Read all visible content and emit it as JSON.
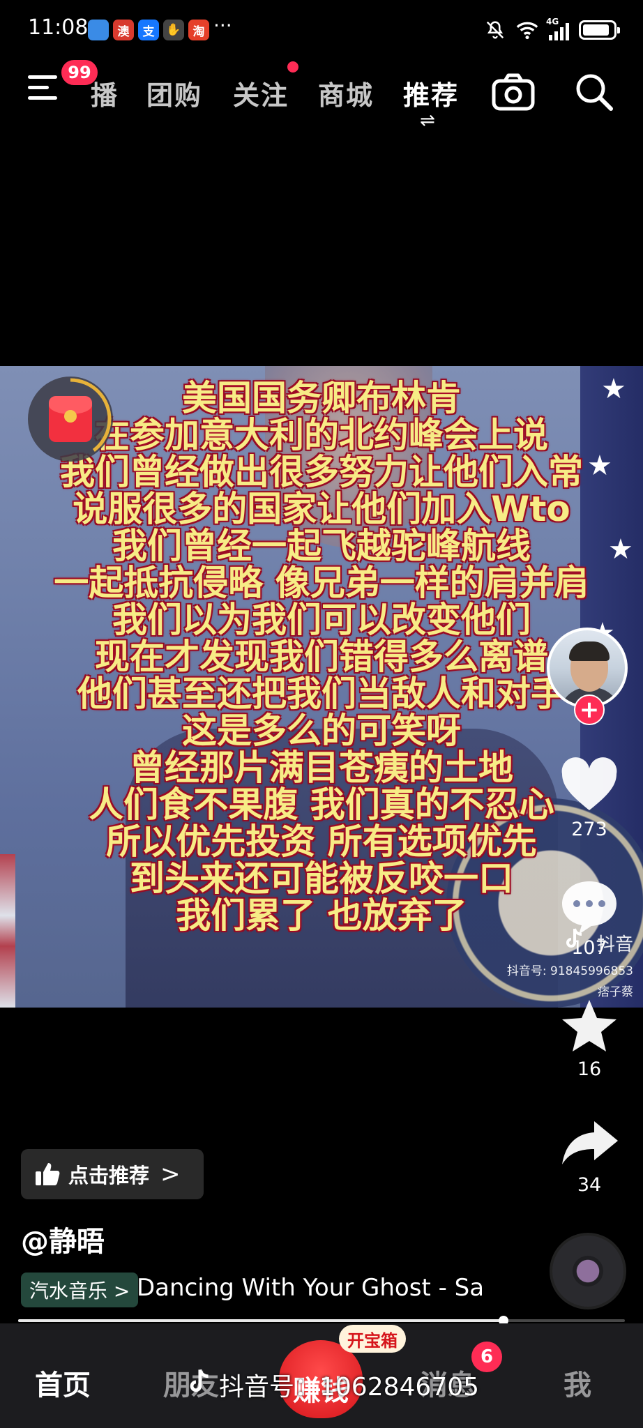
{
  "status_bar": {
    "time": "11:08",
    "more": "···",
    "apps": [
      {
        "name": "browser-app-icon",
        "glyph": "",
        "color": "#3a8be6"
      },
      {
        "name": "aomen-app-icon",
        "glyph": "澳",
        "color": "#d83a2e"
      },
      {
        "name": "alipay-app-icon",
        "glyph": "支",
        "color": "#1677ff"
      },
      {
        "name": "hand-app-icon",
        "glyph": "✋",
        "color": "#444444"
      },
      {
        "name": "taobao-app-icon",
        "glyph": "淘",
        "color": "#e5402a"
      }
    ],
    "network": "4G"
  },
  "top_nav": {
    "menu_badge": "99",
    "tabs": [
      "播",
      "团购",
      "关注",
      "商城",
      "推荐"
    ],
    "active_tab": "推荐",
    "switch_glyph": "⇌"
  },
  "video": {
    "lyrics": [
      "美国国务卿布林肯",
      "在参加意大利的北约峰会上说",
      "我们曾经做出很多努力让他们入常",
      "说服很多的国家让他们加入Wto",
      "我们曾经一起飞越驼峰航线",
      "一起抵抗侵略 像兄弟一样的肩并肩",
      "我们以为我们可以改变他们",
      "现在才发现我们错得多么离谱",
      "他们甚至还把我们当敌人和对手",
      "这是多么的可笑呀",
      "曾经那片满目苍痍的土地",
      "人们食不果腹 我们真的不忍心",
      "所以优先投资 所有选项优先",
      "到头来还可能被反咬一口",
      "我们累了 也放弃了"
    ],
    "watermark_app": "抖音",
    "watermark_id": "抖音号: 91845996853",
    "watermark_user": "痞子蔡"
  },
  "rail": {
    "like_count": "273",
    "comment_count": "107",
    "favorite_count": "16",
    "share_count": "34",
    "follow_glyph": "+"
  },
  "bottom_info": {
    "recommend_label": "点击推荐",
    "recommend_chevron": ">",
    "author": "@静晤",
    "music_tag": "汽水音乐 >",
    "music_title": "Dancing With Your Ghost - Sa",
    "progress": 0.8
  },
  "tab_bar": {
    "tabs": [
      "首页",
      "朋友",
      "赚钱",
      "消息",
      "我"
    ],
    "treasure": "开宝箱",
    "message_badge": "6"
  },
  "bottom_watermark": "抖音号：1062846705"
}
